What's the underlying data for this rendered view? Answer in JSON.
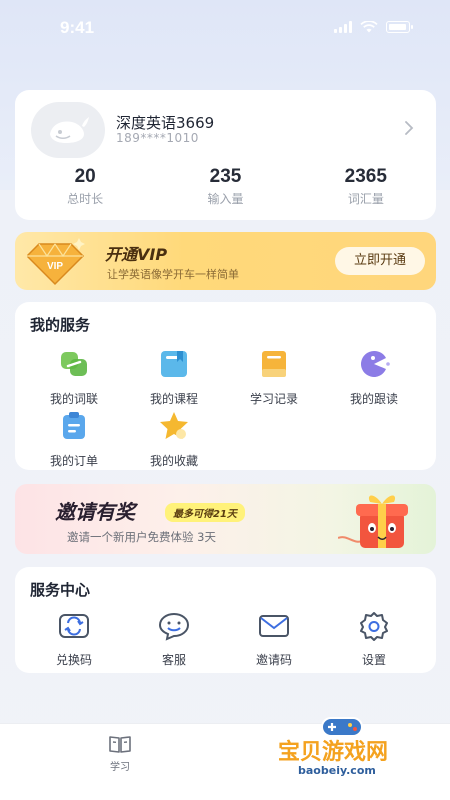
{
  "status_bar": {
    "time": "9:41"
  },
  "profile": {
    "username": "深度英语3669",
    "phone": "189****1010",
    "stats": [
      {
        "value": "20",
        "label": "总时长"
      },
      {
        "value": "235",
        "label": "输入量"
      },
      {
        "value": "2365",
        "label": "词汇量"
      }
    ]
  },
  "vip": {
    "badge": "VIP",
    "title": "开通VIP",
    "subtitle": "让学英语像学开车一样简单",
    "button": "立即开通"
  },
  "services": {
    "title": "我的服务",
    "items": [
      {
        "label": "我的词联",
        "icon": "word-link-icon"
      },
      {
        "label": "我的课程",
        "icon": "course-icon"
      },
      {
        "label": "学习记录",
        "icon": "record-icon"
      },
      {
        "label": "我的跟读",
        "icon": "follow-read-icon"
      },
      {
        "label": "我的订单",
        "icon": "order-icon"
      },
      {
        "label": "我的收藏",
        "icon": "star-icon"
      }
    ]
  },
  "invite": {
    "title": "邀请有奖",
    "tag": "最多可得21天",
    "subtitle": "邀请一个新用户免费体验 3天"
  },
  "service_center": {
    "title": "服务中心",
    "items": [
      {
        "label": "兑换码",
        "icon": "exchange-icon"
      },
      {
        "label": "客服",
        "icon": "customer-service-icon"
      },
      {
        "label": "邀请码",
        "icon": "invite-code-icon"
      },
      {
        "label": "设置",
        "icon": "settings-icon"
      }
    ]
  },
  "bottom_nav": {
    "learn_label": "学习"
  },
  "watermark": {
    "text": "宝贝游戏网",
    "domain": "baobeiy.com"
  },
  "colors": {
    "accent": "#3d6ee0",
    "vip_gold": "#ffd97a",
    "text_primary": "#1f2533"
  }
}
